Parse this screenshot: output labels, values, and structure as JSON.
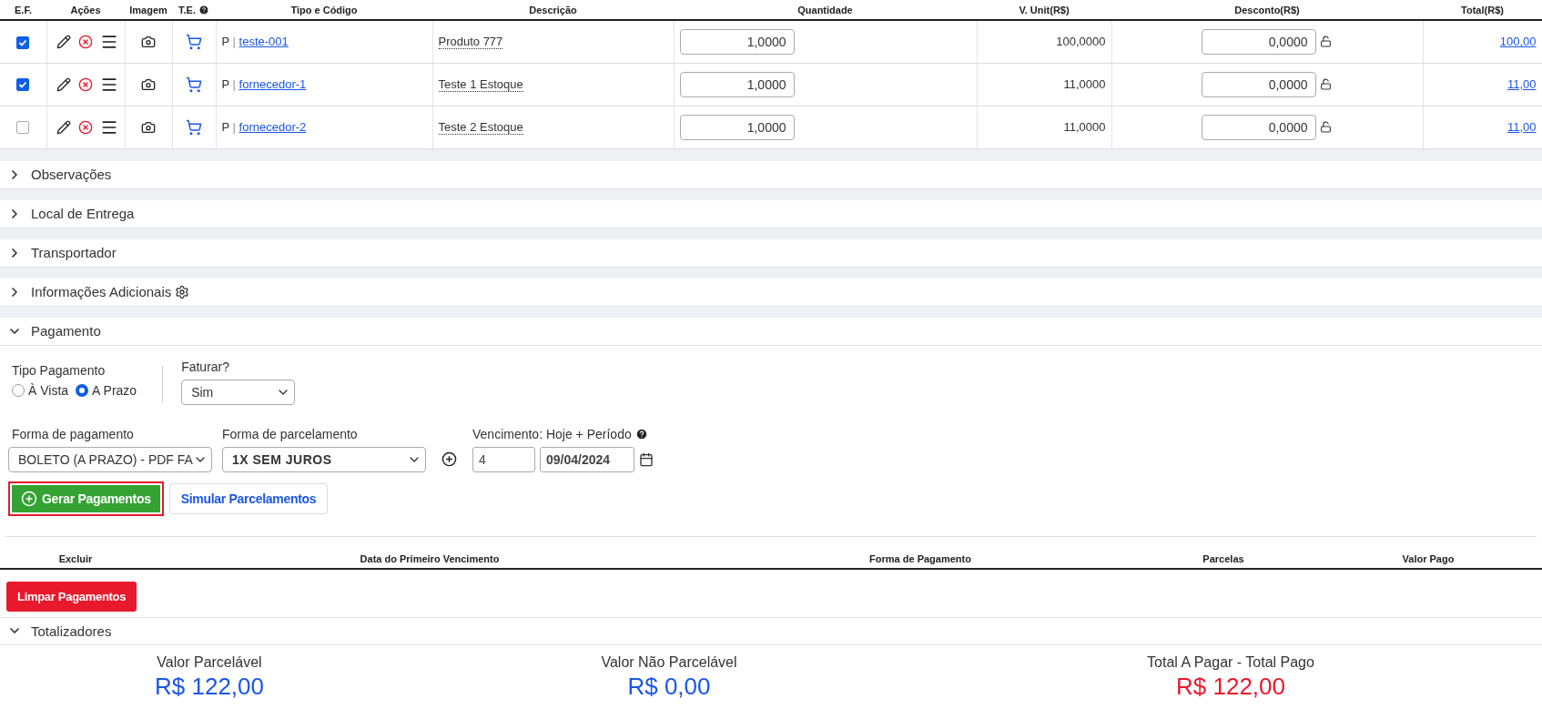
{
  "items_table": {
    "columns": [
      {
        "label": "E.F.",
        "help": false
      },
      {
        "label": "Ações",
        "help": false
      },
      {
        "label": "Imagem",
        "help": false
      },
      {
        "label": "T.E.",
        "help": true
      },
      {
        "label": "Tipo e Código",
        "help": false
      },
      {
        "label": "Descrição",
        "help": false
      },
      {
        "label": "Quantidade",
        "help": false
      },
      {
        "label": "V. Unit(R$)",
        "help": false
      },
      {
        "label": "Desconto(R$)",
        "help": false
      },
      {
        "label": "Total(R$)",
        "help": false
      }
    ],
    "rows": [
      {
        "checked": true,
        "type": "P",
        "separator": "|",
        "code": "teste-001",
        "description": "Produto 777",
        "quantity": "1,0000",
        "unit_value": "100,0000",
        "discount": "0,0000",
        "total": "100,00"
      },
      {
        "checked": true,
        "type": "P",
        "separator": "|",
        "code": "fornecedor-1",
        "description": "Teste 1 Estoque",
        "quantity": "1,0000",
        "unit_value": "11,0000",
        "discount": "0,0000",
        "total": "11,00"
      },
      {
        "checked": false,
        "type": "P",
        "separator": "|",
        "code": "fornecedor-2",
        "description": "Teste 2 Estoque",
        "quantity": "1,0000",
        "unit_value": "11,0000",
        "discount": "0,0000",
        "total": "11,00"
      }
    ]
  },
  "sections": [
    {
      "title": "Observações",
      "expanded": false,
      "kind": "plain"
    },
    {
      "title": "Local de Entrega",
      "expanded": false,
      "kind": "plain"
    },
    {
      "title": "Transportador",
      "expanded": false,
      "kind": "plain"
    },
    {
      "title": "Informações Adicionais",
      "expanded": false,
      "kind": "settings"
    }
  ],
  "payment": {
    "title": "Pagamento",
    "expanded": true,
    "tipo_label": "Tipo Pagamento",
    "radios": [
      {
        "label": "À Vista",
        "selected": false
      },
      {
        "label": "A Prazo",
        "selected": true
      }
    ],
    "faturar_label": "Faturar?",
    "faturar_value": "Sim",
    "forma_pagamento_label": "Forma de pagamento",
    "forma_pagamento_value": "BOLETO (A PRAZO) - PDF FA",
    "parcelamento_label": "Forma de parcelamento",
    "parcelamento_value": "1X SEM JUROS",
    "vencimento_label": "Vencimento: Hoje + Período",
    "days": "4",
    "date": "09/04/2024",
    "gerar_button": "Gerar Pagamentos",
    "simular_button": "Simular Parcelamentos",
    "payments_columns": [
      "Excluir",
      "Data do Primeiro Vencimento",
      "Forma de Pagamento",
      "Parcelas",
      "Valor Pago"
    ],
    "limpar_button": "Limpar Pagamentos"
  },
  "totals": {
    "title": "Totalizadores",
    "expanded": true,
    "items": [
      {
        "label": "Valor Parcelável",
        "value": "R$ 122,00",
        "color": "#1a56e8"
      },
      {
        "label": "Valor Não Parcelável",
        "value": "R$ 0,00",
        "color": "#1a56e8"
      },
      {
        "label": "Total A Pagar - Total Pago",
        "value": "R$ 122,00",
        "color": "#e8192c"
      }
    ]
  }
}
